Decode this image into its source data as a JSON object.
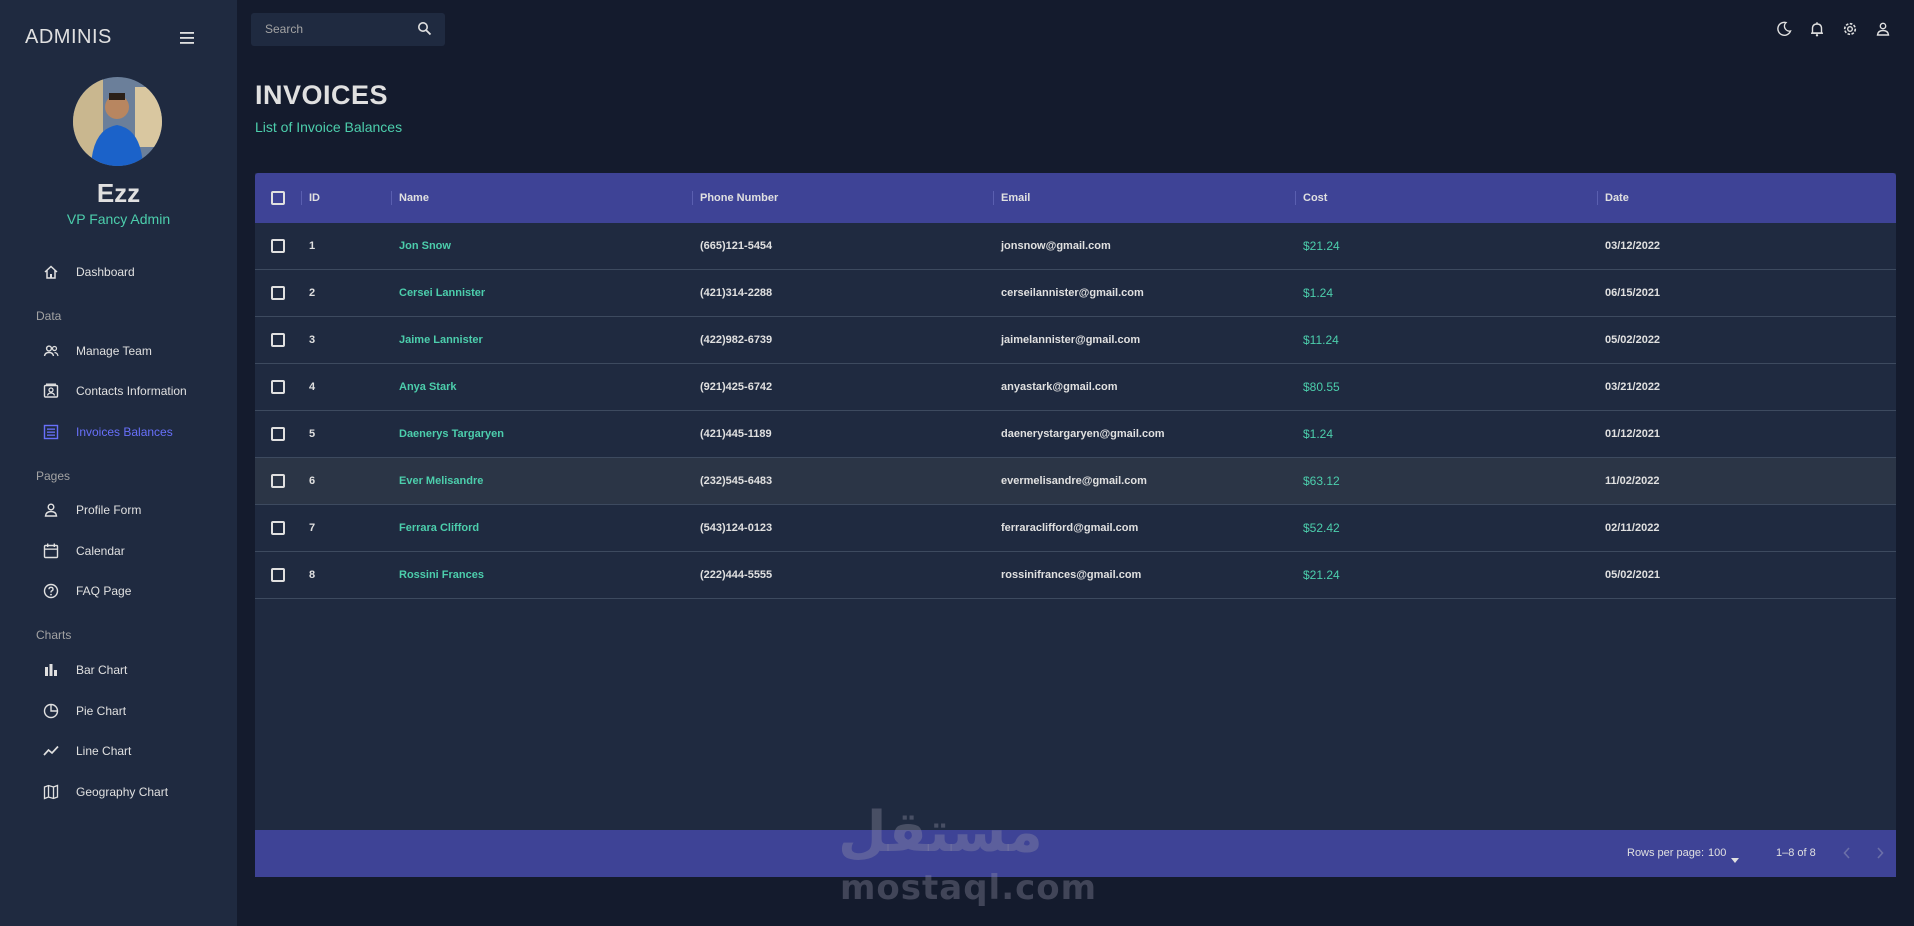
{
  "sidebar": {
    "brand": "ADMINIS",
    "user": {
      "name": "Ezz",
      "role": "VP Fancy Admin"
    },
    "items": [
      {
        "label": "Dashboard",
        "icon": "home-icon"
      },
      {
        "section": "Data"
      },
      {
        "label": "Manage Team",
        "icon": "people-icon"
      },
      {
        "label": "Contacts Information",
        "icon": "contacts-icon"
      },
      {
        "label": "Invoices Balances",
        "icon": "receipt-icon",
        "active": true
      },
      {
        "section": "Pages"
      },
      {
        "label": "Profile Form",
        "icon": "person-icon"
      },
      {
        "label": "Calendar",
        "icon": "calendar-icon"
      },
      {
        "label": "FAQ Page",
        "icon": "help-icon"
      },
      {
        "section": "Charts"
      },
      {
        "label": "Bar Chart",
        "icon": "bar-chart-icon"
      },
      {
        "label": "Pie Chart",
        "icon": "pie-chart-icon"
      },
      {
        "label": "Line Chart",
        "icon": "line-chart-icon"
      },
      {
        "label": "Geography Chart",
        "icon": "map-icon"
      }
    ],
    "sections": {
      "data": "Data",
      "pages": "Pages",
      "charts": "Charts"
    }
  },
  "topbar": {
    "search_placeholder": "Search",
    "icons": [
      "dark-mode-icon",
      "notification-icon",
      "settings-icon",
      "user-icon"
    ]
  },
  "header": {
    "title": "INVOICES",
    "subtitle": "List of Invoice Balances"
  },
  "table": {
    "columns": [
      "ID",
      "Name",
      "Phone Number",
      "Email",
      "Cost",
      "Date"
    ],
    "rows": [
      {
        "id": "1",
        "name": "Jon Snow",
        "phone": "(665)121-5454",
        "email": "jonsnow@gmail.com",
        "cost": "$21.24",
        "date": "03/12/2022"
      },
      {
        "id": "2",
        "name": "Cersei Lannister",
        "phone": "(421)314-2288",
        "email": "cerseilannister@gmail.com",
        "cost": "$1.24",
        "date": "06/15/2021"
      },
      {
        "id": "3",
        "name": "Jaime Lannister",
        "phone": "(422)982-6739",
        "email": "jaimelannister@gmail.com",
        "cost": "$11.24",
        "date": "05/02/2022"
      },
      {
        "id": "4",
        "name": "Anya Stark",
        "phone": "(921)425-6742",
        "email": "anyastark@gmail.com",
        "cost": "$80.55",
        "date": "03/21/2022"
      },
      {
        "id": "5",
        "name": "Daenerys Targaryen",
        "phone": "(421)445-1189",
        "email": "daenerystargaryen@gmail.com",
        "cost": "$1.24",
        "date": "01/12/2021"
      },
      {
        "id": "6",
        "name": "Ever Melisandre",
        "phone": "(232)545-6483",
        "email": "evermelisandre@gmail.com",
        "cost": "$63.12",
        "date": "11/02/2022"
      },
      {
        "id": "7",
        "name": "Ferrara Clifford",
        "phone": "(543)124-0123",
        "email": "ferraraclifford@gmail.com",
        "cost": "$52.42",
        "date": "02/11/2022"
      },
      {
        "id": "8",
        "name": "Rossini Frances",
        "phone": "(222)444-5555",
        "email": "rossinifrances@gmail.com",
        "cost": "$21.24",
        "date": "05/02/2021"
      }
    ],
    "footer": {
      "rows_per_page_label": "Rows per page:",
      "rows_per_page_value": "100",
      "range": "1–8 of 8"
    }
  },
  "watermark": {
    "arabic": "مستقل",
    "latin": "mostaql.com"
  },
  "colors": {
    "background": "#141b2d",
    "panel": "#1f2a40",
    "accent_green": "#4cceac",
    "accent_indigo": "#3e4396",
    "active_blue": "#6870fa"
  }
}
